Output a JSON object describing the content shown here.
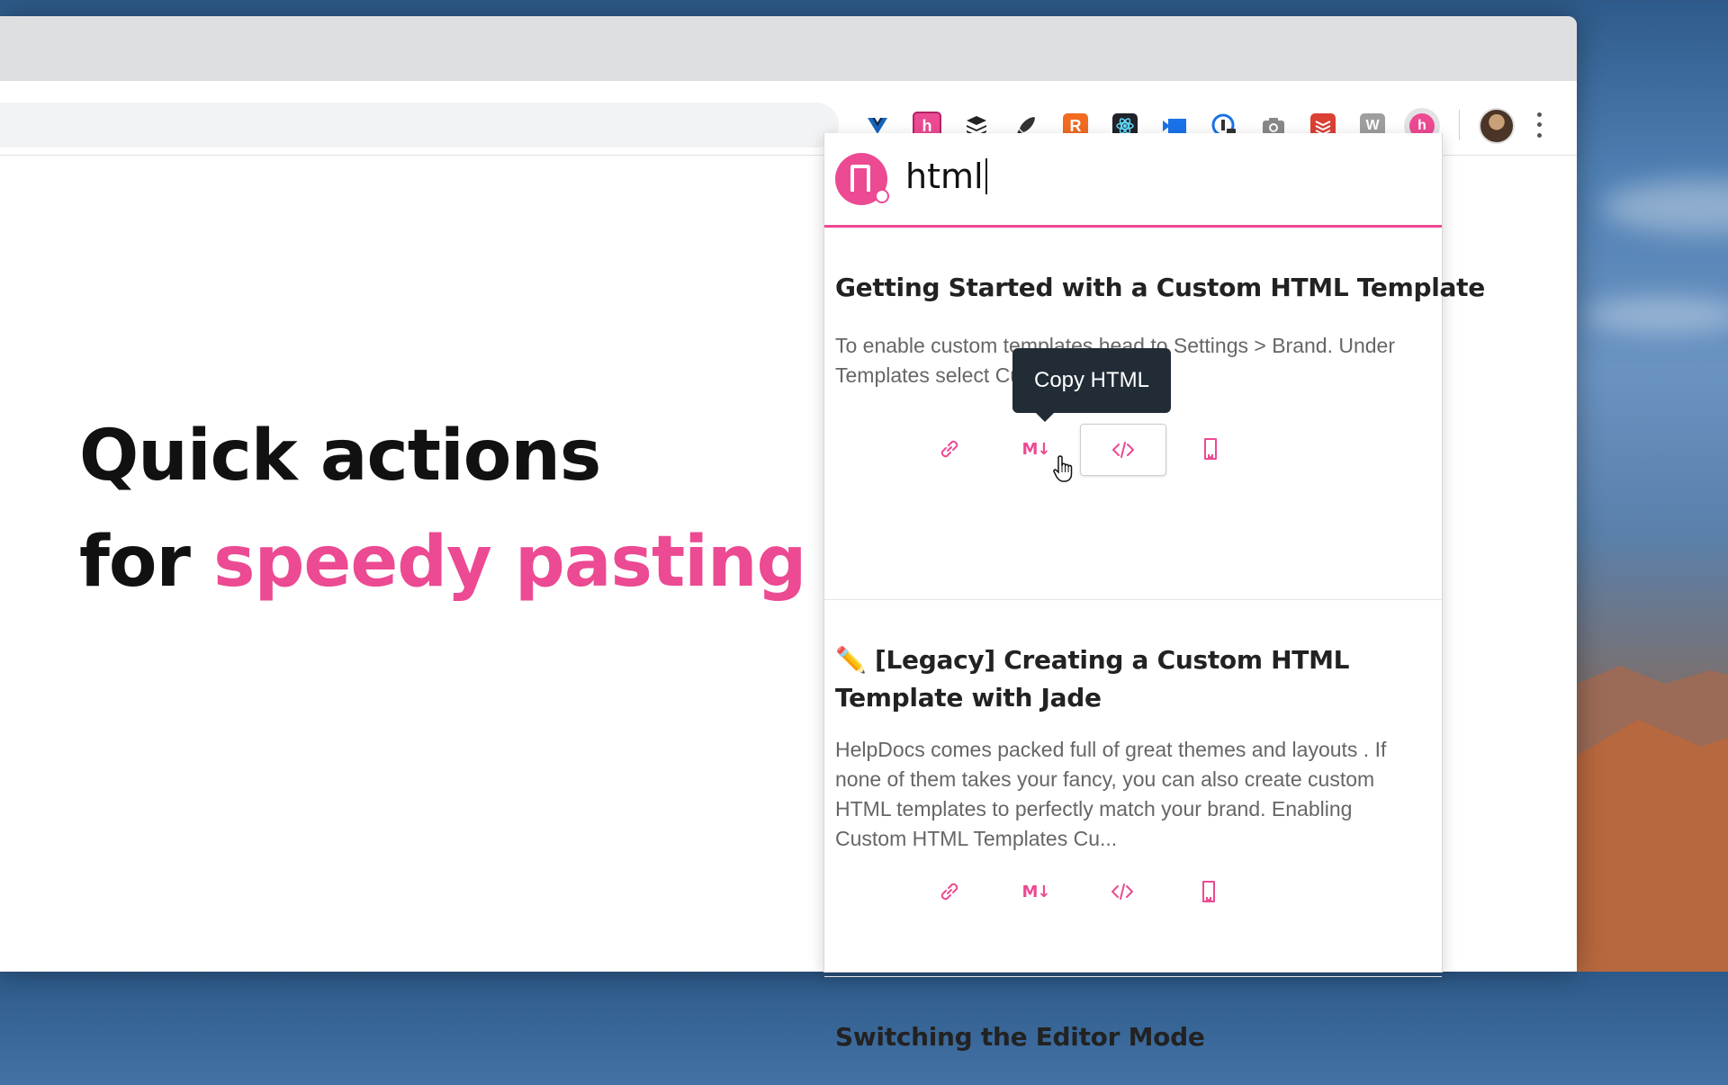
{
  "hero": {
    "line1": "Quick actions",
    "line2_prefix": "for ",
    "line2_highlight": "speedy pasting"
  },
  "colors": {
    "accent": "#ec4a92",
    "tooltip_bg": "#222c37"
  },
  "extensions": [
    "vue-devtools-icon",
    "helpdocs-icon",
    "buffer-icon",
    "rocket-icon",
    "r-extension-icon",
    "react-devtools-icon",
    "dropbox-like-icon",
    "1password-icon",
    "camera-icon",
    "todoist-icon",
    "w-extension-icon",
    "helpdocs-active-icon"
  ],
  "popup": {
    "search_value": "html",
    "results": [
      {
        "title": "Getting Started with a Custom HTML Template",
        "description": "To enable custom templates head to Settings > Brand. Under Templates select Custom and save."
      },
      {
        "title": "✏️ [Legacy] Creating a Custom HTML Template with Jade",
        "description": "HelpDocs comes packed full of great themes and layouts . If none of them takes your fancy, you can also create custom HTML templates to perfectly match your brand. Enabling Custom HTML Templates Cu..."
      },
      {
        "title": "Switching the Editor Mode",
        "description": ""
      }
    ],
    "action_markdown_label": "M↓",
    "tooltip": "Copy HTML"
  }
}
